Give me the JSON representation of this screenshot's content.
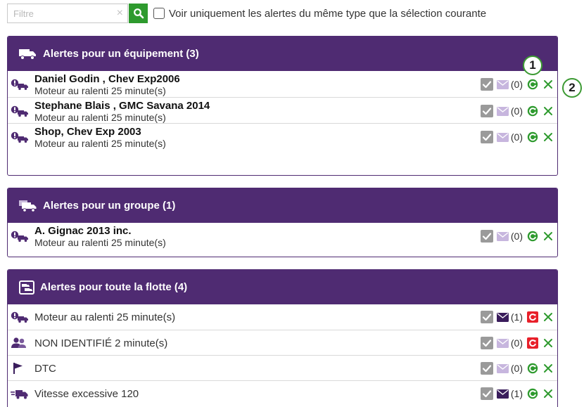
{
  "filter": {
    "placeholder": "Filtre",
    "clear_symbol": "×",
    "search_icon": "magnifier-icon",
    "checkbox_checked": false,
    "checkbox_label": "Voir uniquement les alertes du même type que la sélection courante"
  },
  "colors": {
    "header_purple": "#4f2b72",
    "accent_green": "#2e9a2e",
    "reload_red": "#e8202a",
    "callout_green": "#3c9a33"
  },
  "panels": {
    "equipment": {
      "icon": "truck-icon",
      "title": "Alertes pour un équipement (3)",
      "rows": [
        {
          "icon": "idle-engine-icon",
          "name": "Daniel Godin , Chev Exp2006",
          "desc": "Moteur au ralenti 25 minute(s)",
          "count": "(0)",
          "reload_state": "green",
          "mail_state": "light"
        },
        {
          "icon": "idle-engine-icon",
          "name": "Stephane Blais , GMC Savana 2014",
          "desc": "Moteur au ralenti 25 minute(s)",
          "count": "(0)",
          "reload_state": "green",
          "mail_state": "light"
        },
        {
          "icon": "idle-engine-icon",
          "name": "Shop, Chev Exp 2003",
          "desc": "Moteur au ralenti 25 minute(s)",
          "count": "(0)",
          "reload_state": "green",
          "mail_state": "light"
        }
      ]
    },
    "group": {
      "icon": "trucks-group-icon",
      "title": "Alertes pour un groupe (1)",
      "rows": [
        {
          "icon": "idle-engine-icon",
          "name": "A. Gignac 2013 inc.",
          "desc": "Moteur au ralenti 25 minute(s)",
          "count": "(0)",
          "reload_state": "green",
          "mail_state": "light"
        }
      ]
    },
    "fleet": {
      "icon": "fleet-map-icon",
      "title": "Alertes pour toute la flotte (4)",
      "rows": [
        {
          "icon": "idle-engine-icon",
          "desc": "Moteur au ralenti 25 minute(s)",
          "count": "(1)",
          "reload_state": "red",
          "mail_state": "dark"
        },
        {
          "icon": "unidentified-driver-icon",
          "desc": "NON IDENTIFIÉ 2 minute(s)",
          "count": "(0)",
          "reload_state": "red",
          "mail_state": "light"
        },
        {
          "icon": "flag-icon",
          "desc": "DTC",
          "count": "(0)",
          "reload_state": "green",
          "mail_state": "light"
        },
        {
          "icon": "speeding-truck-icon",
          "desc": "Vitesse excessive 120",
          "count": "(1)",
          "reload_state": "green",
          "mail_state": "dark"
        }
      ]
    }
  },
  "callouts": [
    "1",
    "2"
  ]
}
